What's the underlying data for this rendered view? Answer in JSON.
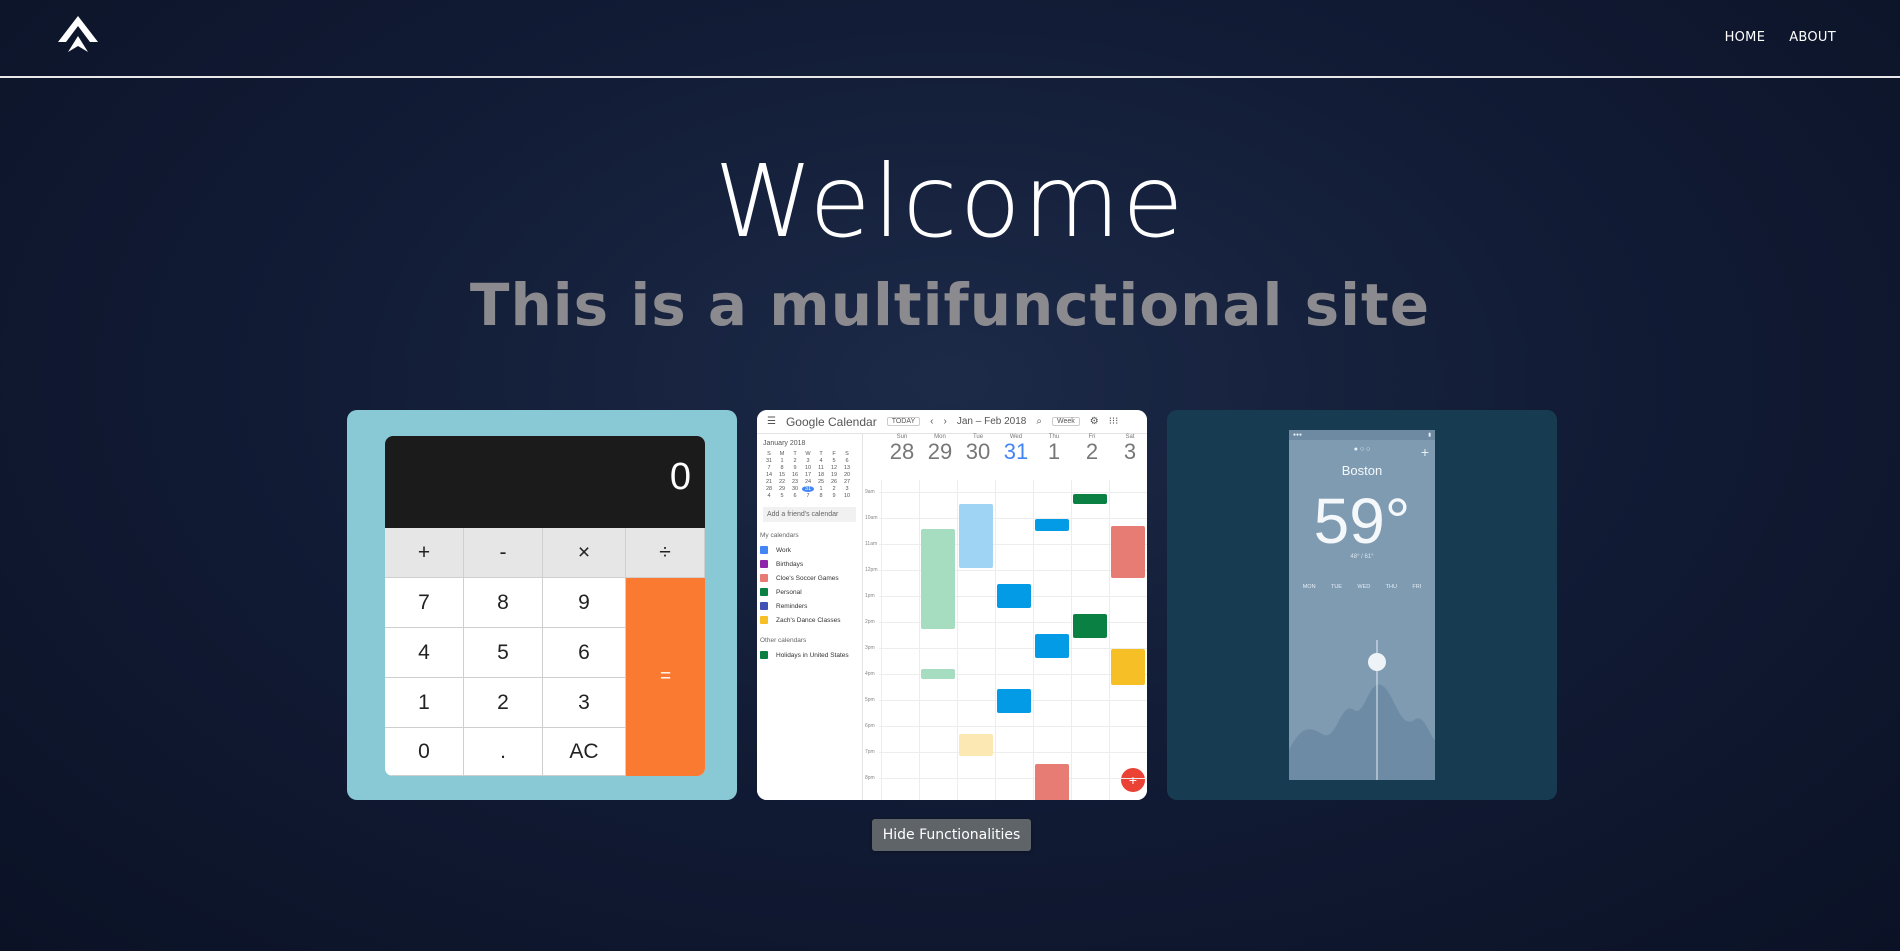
{
  "nav": {
    "logo_icon": "triangle-logo-icon",
    "links": [
      "HOME",
      "ABOUT"
    ]
  },
  "hero": {
    "title": "Welcome",
    "subtitle": "This is a multifunctional site"
  },
  "cards": [
    {
      "name": "calculator",
      "display": "0",
      "operators": [
        "+",
        "-",
        "×",
        "÷"
      ],
      "rows": [
        [
          "7",
          "8",
          "9"
        ],
        [
          "4",
          "5",
          "6"
        ],
        [
          "1",
          "2",
          "3"
        ],
        [
          "0",
          ".",
          "AC"
        ]
      ],
      "equals": "=",
      "colors": {
        "card": "#89c9d6",
        "equals": "#fb7a32",
        "display": "#1b1b1b"
      }
    },
    {
      "name": "calendar",
      "brand": "Google Calendar",
      "today_label": "TODAY",
      "range": "Jan – Feb 2018",
      "view": "Week",
      "mini_month": "January 2018",
      "weekday_initials": [
        "S",
        "M",
        "T",
        "W",
        "T",
        "F",
        "S"
      ],
      "mini_days": [
        "31",
        "1",
        "2",
        "3",
        "4",
        "5",
        "6",
        "7",
        "8",
        "9",
        "10",
        "11",
        "12",
        "13",
        "14",
        "15",
        "16",
        "17",
        "18",
        "19",
        "20",
        "21",
        "22",
        "23",
        "24",
        "25",
        "26",
        "27",
        "28",
        "29",
        "30",
        "31",
        "1",
        "2",
        "3",
        "4",
        "5",
        "6",
        "7",
        "8",
        "9",
        "10"
      ],
      "add_friend": "Add a friend's calendar",
      "my_calendars_label": "My calendars",
      "my_calendars": [
        {
          "label": "Work",
          "color": "#4285f4"
        },
        {
          "label": "Birthdays",
          "color": "#8e24aa"
        },
        {
          "label": "Cloe's Soccer Games",
          "color": "#e67c73"
        },
        {
          "label": "Personal",
          "color": "#0b8043"
        },
        {
          "label": "Reminders",
          "color": "#3f51b5"
        },
        {
          "label": "Zach's Dance Classes",
          "color": "#f6bf26"
        }
      ],
      "other_calendars_label": "Other calendars",
      "other_calendars": [
        {
          "label": "Holidays in United States",
          "color": "#0b8043"
        }
      ],
      "days": [
        {
          "name": "Sun",
          "num": "28"
        },
        {
          "name": "Mon",
          "num": "29"
        },
        {
          "name": "Tue",
          "num": "30"
        },
        {
          "name": "Wed",
          "num": "31"
        },
        {
          "name": "Thu",
          "num": "1"
        },
        {
          "name": "Fri",
          "num": "2"
        },
        {
          "name": "Sat",
          "num": "3"
        }
      ],
      "times": [
        "9am",
        "10am",
        "11am",
        "12pm",
        "1pm",
        "2pm",
        "3pm",
        "4pm",
        "5pm",
        "6pm",
        "7pm",
        "8pm"
      ]
    },
    {
      "name": "weather",
      "city": "Boston",
      "temp": "59°",
      "range": "48° / 61°",
      "days": [
        "MON",
        "TUE",
        "WED",
        "THU",
        "FRI"
      ],
      "colors": {
        "card": "#173c52",
        "phone": "#7f9bb2"
      }
    }
  ],
  "button": {
    "hide_label": "Hide Functionalities"
  }
}
